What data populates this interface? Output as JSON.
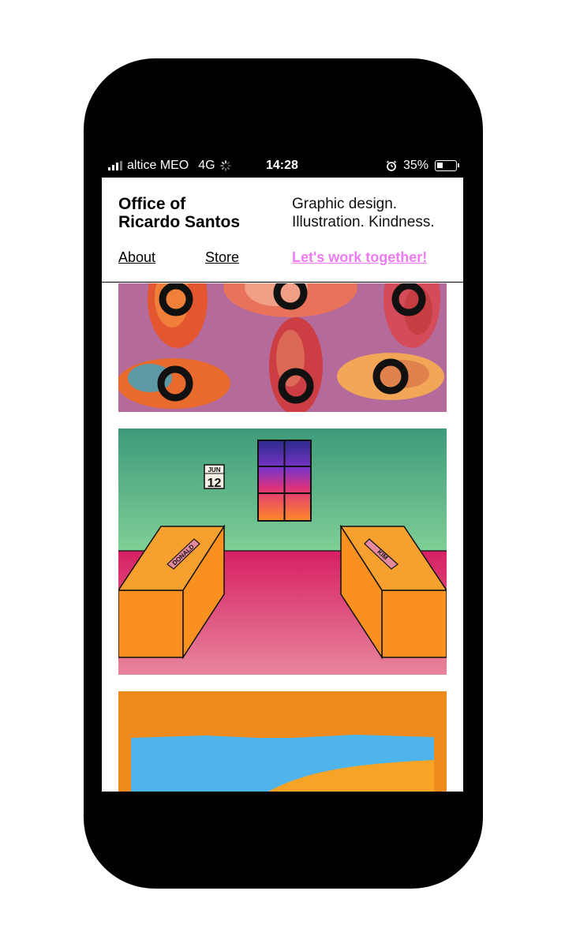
{
  "status_bar": {
    "carrier": "altice MEO",
    "network": "4G",
    "time": "14:28",
    "battery_percent": "35%",
    "battery_level": 0.35
  },
  "header": {
    "brand_line1": "Office of",
    "brand_line2": "Ricardo Santos",
    "tagline_line1": "Graphic design.",
    "tagline_line2": "Illustration. Kindness."
  },
  "nav": {
    "about": "About",
    "store": "Store",
    "cta": "Let's work together!"
  },
  "artworks": {
    "calendar_month": "JUN",
    "calendar_day": "12",
    "desk_left_label": "DONALD",
    "desk_right_label": "KIM"
  },
  "colors": {
    "accent": "#f07af5",
    "phone": "#000000"
  }
}
